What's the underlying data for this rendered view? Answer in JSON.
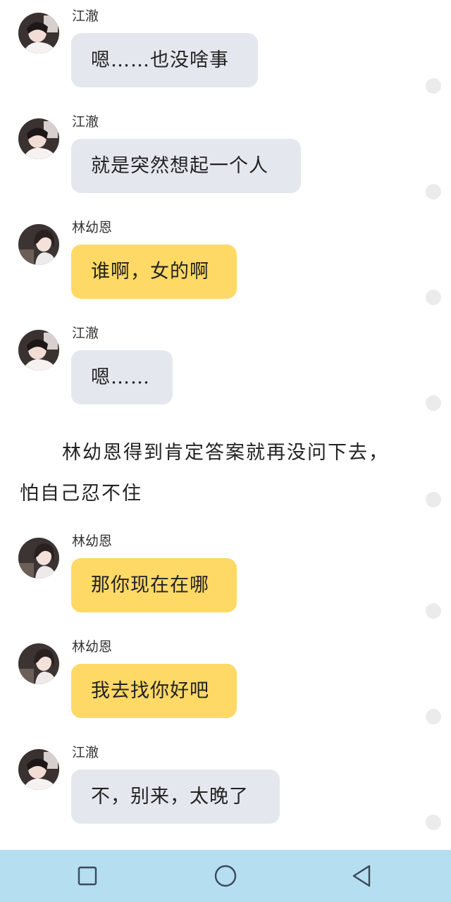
{
  "messages": [
    {
      "sender": "江澈",
      "text": "嗯……也没啥事",
      "speaker": "jiangche"
    },
    {
      "sender": "江澈",
      "text": "就是突然想起一个人",
      "speaker": "jiangche"
    },
    {
      "sender": "林幼恩",
      "text": "谁啊，女的啊",
      "speaker": "linyouen"
    },
    {
      "sender": "江澈",
      "text": "嗯……",
      "speaker": "jiangche"
    }
  ],
  "narration": {
    "line1": "林幼恩得到肯定答案就再没问下去，",
    "line2": "怕自己忍不住"
  },
  "messages2": [
    {
      "sender": "林幼恩",
      "text": "那你现在在哪",
      "speaker": "linyouen"
    },
    {
      "sender": "林幼恩",
      "text": "我去找你好吧",
      "speaker": "linyouen"
    },
    {
      "sender": "江澈",
      "text": "不，别来，太晚了",
      "speaker": "jiangche"
    }
  ],
  "colors": {
    "jiangche_bubble": "#e4e8ee",
    "linyouen_bubble": "#fed966",
    "navbar": "#b6def1",
    "nav_icon": "#3a4a5a"
  },
  "navigation": {
    "recent_icon": "square-recents-icon",
    "home_icon": "circle-home-icon",
    "back_icon": "triangle-back-icon"
  }
}
